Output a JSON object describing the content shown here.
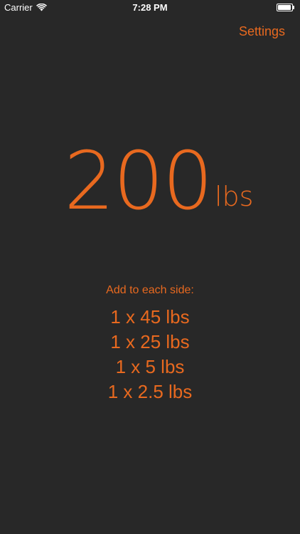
{
  "status_bar": {
    "carrier": "Carrier",
    "time": "7:28 PM",
    "wifi_icon": "wifi-icon",
    "battery_icon": "battery-icon"
  },
  "nav": {
    "settings_label": "Settings"
  },
  "weight": {
    "value": "200",
    "unit": "lbs"
  },
  "plates": {
    "heading": "Add to each side:",
    "items": [
      "1 x 45 lbs",
      "1 x 25 lbs",
      "1 x 5 lbs",
      "1 x 2.5 lbs"
    ]
  },
  "colors": {
    "background": "#282828",
    "accent": "#e8691f",
    "status_text": "#ffffff"
  }
}
